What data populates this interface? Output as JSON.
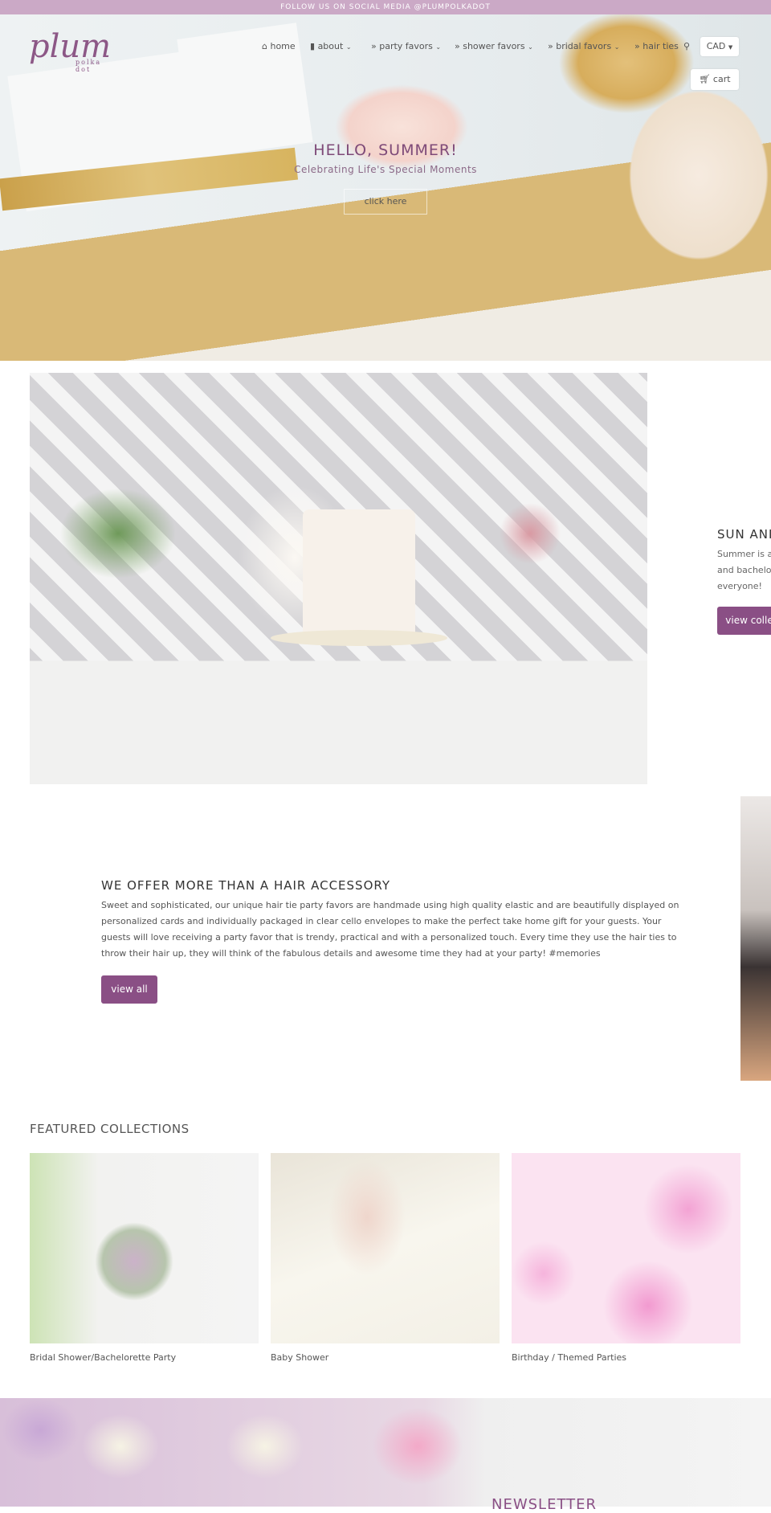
{
  "announcement": "FOLLOW US ON SOCIAL MEDIA @PLUMPOLKADOT",
  "logo": {
    "main": "plum",
    "sub": "polka dot"
  },
  "nav": [
    {
      "label": "home",
      "icon": "home-icon"
    },
    {
      "label": "about",
      "icon": "bookmark-icon",
      "dropdown": true
    },
    {
      "label": "party favors",
      "icon": "double-chevron-icon",
      "dropdown": true
    },
    {
      "label": "shower favors",
      "icon": "double-chevron-icon",
      "dropdown": true
    },
    {
      "label": "bridal favors",
      "icon": "double-chevron-icon",
      "dropdown": true
    },
    {
      "label": "hair ties",
      "icon": "double-chevron-icon"
    }
  ],
  "currency": "CAD",
  "cart_label": "cart",
  "hero": {
    "title": "HELLO, SUMMER!",
    "subtitle": "Celebrating Life's Special Moments",
    "button": "click here"
  },
  "slide1": {
    "title": "SUN ANI",
    "lines": [
      "Summer is a",
      "and bachelo",
      "everyone!"
    ],
    "button": "view colle"
  },
  "about": {
    "title": "WE OFFER MORE THAN A HAIR ACCESSORY",
    "text": "Sweet and sophisticated, our unique hair tie party favors are handmade using high quality elastic and are beautifully displayed on personalized cards and individually packaged in clear cello envelopes to make the perfect take home gift for your guests. Your guests will love receiving a party favor that is trendy, practical and with a personalized touch. Every time they use the hair ties to throw their hair up, they will think of the fabulous details and awesome time they had at your party!  #memories",
    "button": "view all"
  },
  "featured": {
    "title": "FEATURED COLLECTIONS",
    "items": [
      "Bridal Shower/Bachelorette Party",
      "Baby Shower",
      "Birthday / Themed Parties"
    ]
  },
  "newsletter": {
    "title": "NEWSLETTER"
  },
  "colors": {
    "accent": "#8a4f85",
    "topbar": "#cba9c6"
  }
}
